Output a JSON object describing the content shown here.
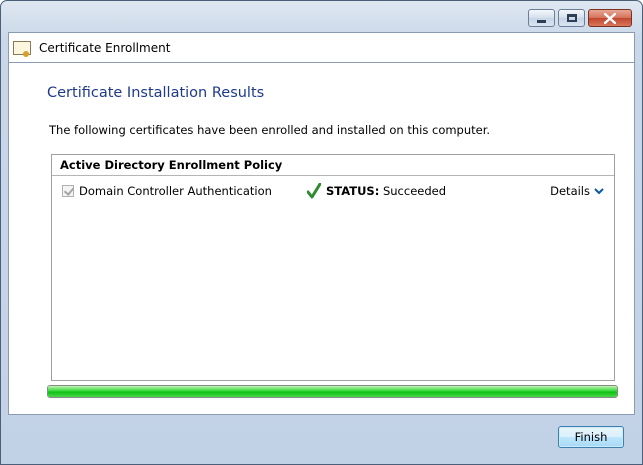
{
  "window": {
    "title": "Certificate Enrollment"
  },
  "page": {
    "heading": "Certificate Installation Results",
    "description": "The following certificates have been enrolled and installed on this computer."
  },
  "policy": {
    "name": "Active Directory Enrollment Policy",
    "items": [
      {
        "name": "Domain Controller Authentication",
        "checked": true,
        "status_label": "STATUS:",
        "status_value": "Succeeded",
        "details_label": "Details"
      }
    ]
  },
  "progress": {
    "percent": 100,
    "color": "#1ec51f"
  },
  "buttons": {
    "finish_label": "Finish"
  },
  "colors": {
    "heading": "#1e3a8a",
    "accent": "#0b57a4",
    "status_check": "#2e8b2e"
  },
  "icons": {
    "title_icon": "certificate-icon",
    "status_icon": "check-mark-icon",
    "details_icon": "chevron-down-icon"
  }
}
